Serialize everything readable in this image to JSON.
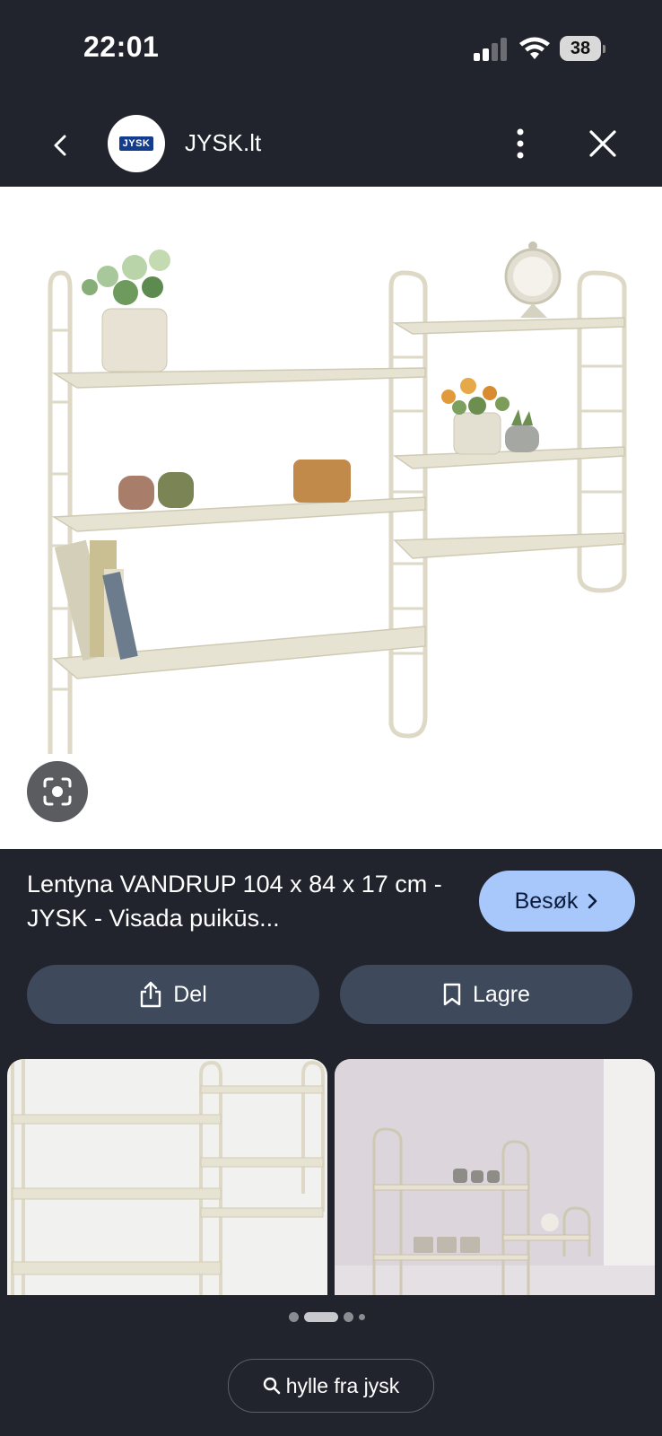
{
  "status_bar": {
    "time": "22:01",
    "battery": "38"
  },
  "header": {
    "site_name": "JYSK.lt",
    "logo_text": "JYSK"
  },
  "result": {
    "title": "Lentyna VANDRUP 104 x 84 x 17 cm - JYSK - Visada puikūs...",
    "visit_label": "Besøk"
  },
  "actions": {
    "share_label": "Del",
    "save_label": "Lagre"
  },
  "search": {
    "query": "hylle fra jysk"
  },
  "colors": {
    "background": "#22242d",
    "visit_button": "#a8c7fa",
    "action_button": "#3e495c"
  },
  "icons": [
    "back-icon",
    "more-vert-icon",
    "close-icon",
    "lens-icon",
    "share-icon",
    "bookmark-icon",
    "chevron-right-icon",
    "search-icon"
  ]
}
